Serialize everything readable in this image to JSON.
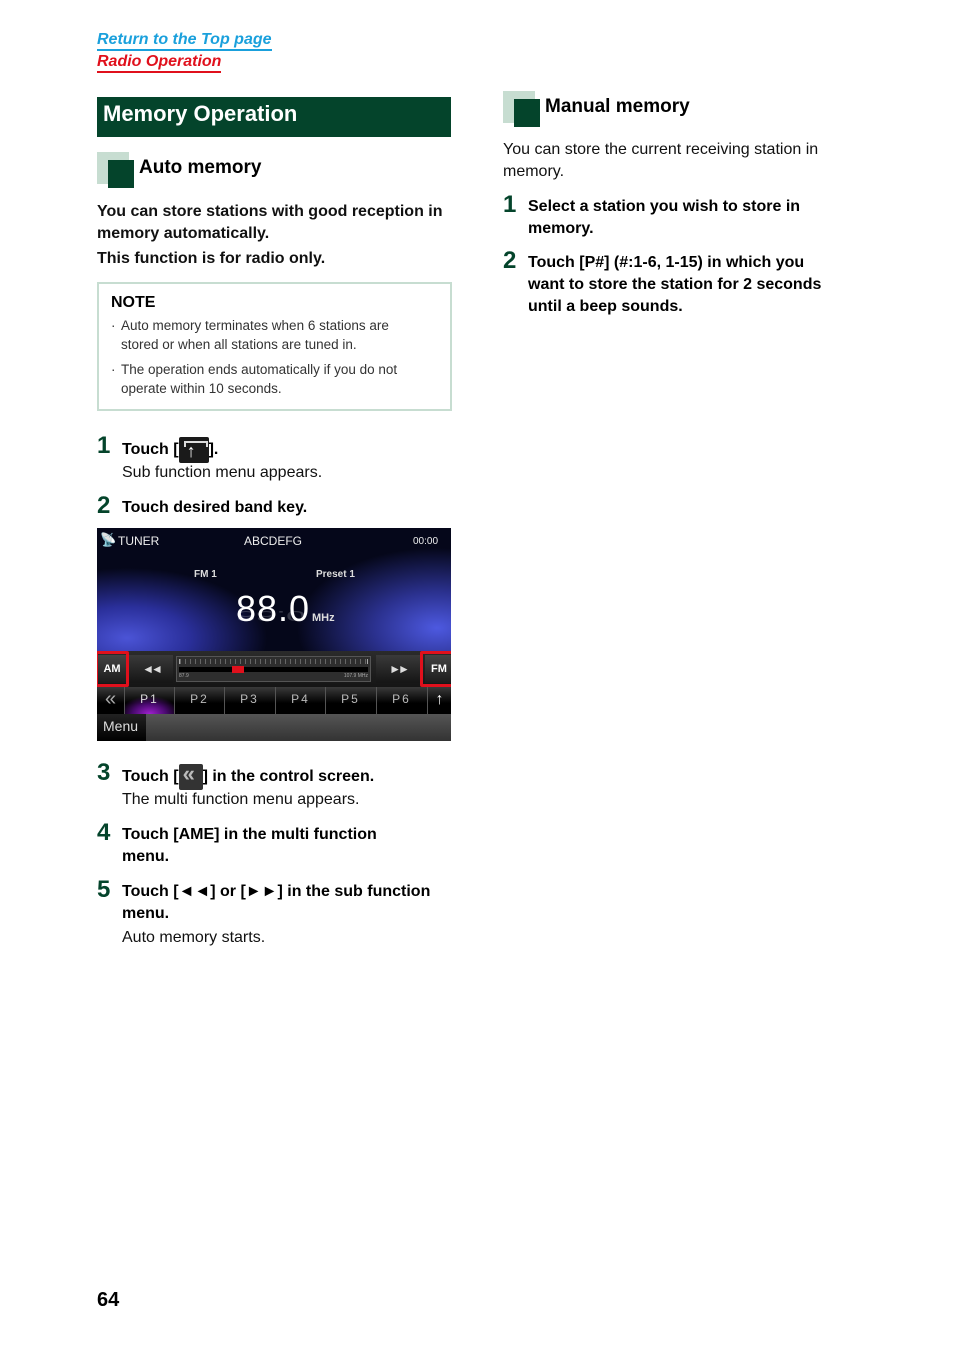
{
  "nav": {
    "top_page_link": "Return to the Top page",
    "section_link": "Radio Operation"
  },
  "colors": {
    "heading_green": "#04442b",
    "accent_light_green": "#c7ddd1",
    "link_blue": "#1aa0dc",
    "link_red": "#e0101c",
    "highlight_red": "#e0101c"
  },
  "section_title": "Memory Operation",
  "auto_memory": {
    "heading": "Auto memory",
    "intro_line1": "You can store stations with good reception in",
    "intro_line2": "memory automatically.",
    "intro_line3": "This function is for radio only.",
    "note": {
      "title": "NOTE",
      "items": [
        {
          "line1": "Auto memory terminates when 6 stations are",
          "line2": "stored or when all stations are tuned in."
        },
        {
          "line1": "The operation ends automatically if you do not",
          "line2": "operate within 10 seconds."
        }
      ]
    },
    "steps": [
      {
        "number": "1",
        "instr_before": "Touch [",
        "icon": "upload-icon",
        "instr_after": "].",
        "result": "Sub function menu appears."
      },
      {
        "number": "2",
        "instr": "Touch desired band key."
      },
      {
        "number": "3",
        "instr_before": "Touch [",
        "icon": "double-chevron-left-icon",
        "instr_after": "] in the control screen.",
        "result": "The multi function menu appears."
      },
      {
        "number": "4",
        "instr_line1": "Touch [AME] in the multi function",
        "instr_line2": "menu."
      },
      {
        "number": "5",
        "instr_line1": "Touch [◄◄] or [►►] in the sub function",
        "instr_line2": "menu.",
        "result": "Auto memory starts."
      }
    ]
  },
  "tuner_screen": {
    "source": "TUNER",
    "station_name": "ABCDEFG",
    "clock": "00:00",
    "band": "FM 1",
    "preset": "Preset 1",
    "frequency": "88.0",
    "unit": "MHz",
    "am_button": "AM",
    "fm_button": "FM",
    "seek_back": "◄◄",
    "seek_forward": "►►",
    "seek_min_label": "87.9",
    "seek_max_label": "107.9 MHz",
    "seek_position_fraction": 0.3,
    "presets": [
      "P1",
      "P2",
      "P3",
      "P4",
      "P5",
      "P6"
    ],
    "active_preset": "P1",
    "back_glyph": "«",
    "up_glyph": "↑",
    "menu_button": "Menu"
  },
  "manual_memory": {
    "heading": "Manual memory",
    "intro_line1": "You can store the current receiving station in",
    "intro_line2": "memory.",
    "steps": [
      {
        "number": "1",
        "instr_line1": "Select a station you wish to store in",
        "instr_line2": "memory."
      },
      {
        "number": "2",
        "instr_line1": "Touch [P#] (#:1-6, 1-15) in which you",
        "instr_line2": "want to store the station for 2 seconds",
        "instr_line3": "until a beep sounds."
      }
    ]
  },
  "page_number": "64"
}
